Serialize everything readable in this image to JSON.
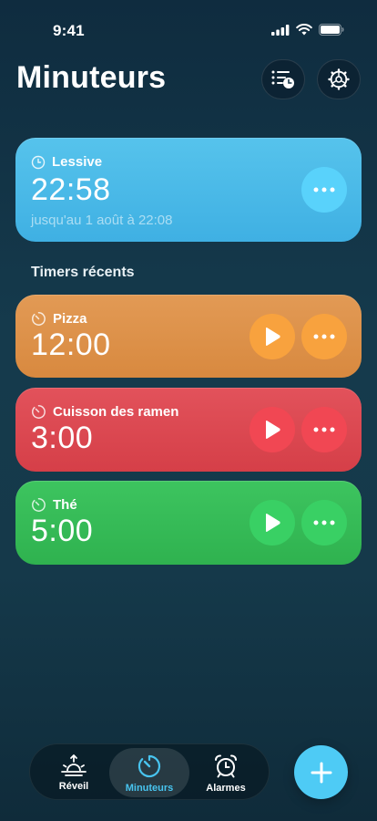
{
  "status_bar": {
    "time": "9:41"
  },
  "header": {
    "title": "Minuteurs"
  },
  "active_timer": {
    "label": "Lessive",
    "time": "22:58",
    "until": "jusqu'au 1 août à 22:08",
    "color": "#4fbcea"
  },
  "recent": {
    "title": "Timers récents",
    "items": [
      {
        "label": "Pizza",
        "time": "12:00",
        "color": "#dc9049"
      },
      {
        "label": "Cuisson des ramen",
        "time": "3:00",
        "color": "#d94750"
      },
      {
        "label": "Thé",
        "time": "5:00",
        "color": "#35bb57"
      }
    ]
  },
  "tabs": [
    {
      "label": "Réveil",
      "icon": "sunrise-icon"
    },
    {
      "label": "Minuteurs",
      "icon": "timer-icon",
      "active": true
    },
    {
      "label": "Alarmes",
      "icon": "alarm-clock-icon"
    }
  ],
  "colors": {
    "accent": "#4ecbf5",
    "active_tab_label": "#48c4ef"
  }
}
